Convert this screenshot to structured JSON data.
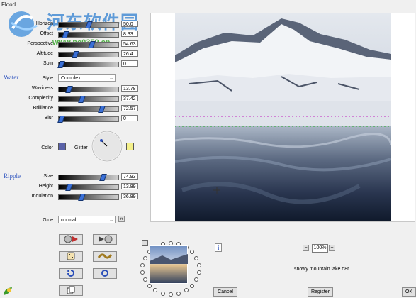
{
  "window": {
    "title": "Flood"
  },
  "watermark": {
    "text": "河东软件园",
    "url": "www.pc0359.cn"
  },
  "sections": {
    "water": "Water",
    "ripple": "Ripple"
  },
  "view_sliders": [
    {
      "label": "Horizon",
      "value": "50.0",
      "pos": 0.5
    },
    {
      "label": "Offset",
      "value": "8.33",
      "pos": 0.08
    },
    {
      "label": "Perspective",
      "value": "54.63",
      "pos": 0.55
    },
    {
      "label": "Altitude",
      "value": "26.4",
      "pos": 0.26
    },
    {
      "label": "Spin",
      "value": "0",
      "pos": 0.0
    }
  ],
  "water": {
    "style_label": "Style",
    "style_value": "Complex",
    "sliders": [
      {
        "label": "Waviness",
        "value": "13.78",
        "pos": 0.14
      },
      {
        "label": "Complexity",
        "value": "37.42",
        "pos": 0.37
      },
      {
        "label": "Brilliance",
        "value": "72.57",
        "pos": 0.73
      },
      {
        "label": "Blur",
        "value": "0",
        "pos": 0.0
      }
    ],
    "color_label": "Color",
    "glitter_label": "Glitter",
    "color": "#5a62a8",
    "glitter_color": "#f4f08a"
  },
  "ripple": {
    "sliders": [
      {
        "label": "Size",
        "value": "74.93",
        "pos": 0.75
      },
      {
        "label": "Height",
        "value": "13.89",
        "pos": 0.14
      },
      {
        "label": "Undulation",
        "value": "36.89",
        "pos": 0.37
      }
    ]
  },
  "glue": {
    "label": "Glue",
    "value": "normal"
  },
  "preset": {
    "name": "snowy mountain lake.q8r"
  },
  "zoom": {
    "value": "100%",
    "minus": "−",
    "plus": "+"
  },
  "buttons": {
    "cancel": "Cancel",
    "register": "Register",
    "ok": "OK",
    "info": "i"
  }
}
